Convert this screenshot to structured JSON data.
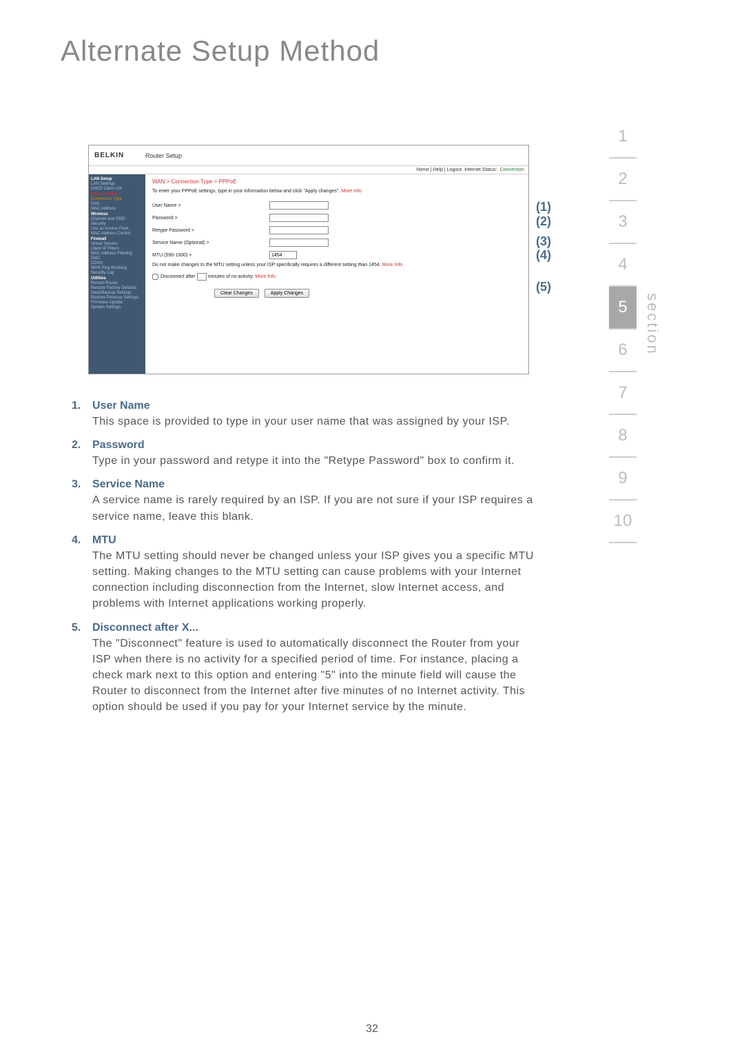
{
  "page_title": "Alternate Setup Method",
  "page_number": "32",
  "section_label": "section",
  "tabs": [
    "1",
    "2",
    "3",
    "4",
    "5",
    "6",
    "7",
    "8",
    "9",
    "10"
  ],
  "active_tab": 4,
  "screenshot": {
    "logo": "BELKIN",
    "title": "Router Setup",
    "status_links": "Home | Help | Logout",
    "status_label": "Internet Status:",
    "status_value": "Connection",
    "breadcrumb": "WAN > Connection Type > PPPoE",
    "instruction_prefix": "To enter your PPPoE settings, type in your information below and click \"Apply changes\". ",
    "more_info": "More Info",
    "sidebar": [
      {
        "text": "LAN Setup",
        "cls": "hdr"
      },
      {
        "text": "LAN Settings",
        "cls": "item"
      },
      {
        "text": "DHCP Client List",
        "cls": "item"
      },
      {
        "text": "Internet WAN",
        "cls": "hdr red"
      },
      {
        "text": "Connection Type",
        "cls": "item orange"
      },
      {
        "text": "DNS",
        "cls": "item"
      },
      {
        "text": "MAC Address",
        "cls": "item"
      },
      {
        "text": "Wireless",
        "cls": "hdr"
      },
      {
        "text": "Channel and SSID",
        "cls": "item"
      },
      {
        "text": "Security",
        "cls": "item"
      },
      {
        "text": "Use as Access Point",
        "cls": "item"
      },
      {
        "text": "MAC Address Control",
        "cls": "item"
      },
      {
        "text": "Firewall",
        "cls": "hdr"
      },
      {
        "text": "Virtual Servers",
        "cls": "item"
      },
      {
        "text": "Client IP Filters",
        "cls": "item"
      },
      {
        "text": "MAC Address Filtering",
        "cls": "item"
      },
      {
        "text": "DMZ",
        "cls": "item"
      },
      {
        "text": "DDNS",
        "cls": "item"
      },
      {
        "text": "WAN Ping Blocking",
        "cls": "item"
      },
      {
        "text": "Security Log",
        "cls": "item"
      },
      {
        "text": "Utilities",
        "cls": "hdr"
      },
      {
        "text": "Restart Router",
        "cls": "item"
      },
      {
        "text": "Restore Factory Defaults",
        "cls": "item"
      },
      {
        "text": "Save/Backup Settings",
        "cls": "item"
      },
      {
        "text": "Restore Previous Settings",
        "cls": "item"
      },
      {
        "text": "Firmware Update",
        "cls": "item"
      },
      {
        "text": "System Settings",
        "cls": "item"
      }
    ],
    "fields": {
      "username": "User Name >",
      "password": "Password >",
      "retype": "Retype Password >",
      "service": "Service Name (Optional) >",
      "mtu": "MTU (590-1500) >",
      "mtu_value": "1454"
    },
    "mtu_note_prefix": "Do not make changes to the MTU setting unless your ISP specifically requires a different setting than 1454. ",
    "disconnect_prefix": "Disconnect after",
    "disconnect_suffix_a": "minutes of no activity.",
    "buttons": {
      "clear": "Clear Changes",
      "apply": "Apply Changes"
    }
  },
  "callouts": {
    "c1": "(1)",
    "c2": "(2)",
    "c3": "(3)",
    "c4": "(4)",
    "c5": "(5)"
  },
  "list": [
    {
      "num": "1.",
      "title": "User Name",
      "text": "This space is provided to type in your user name that was assigned by your ISP."
    },
    {
      "num": "2.",
      "title": "Password",
      "text": "Type in your password and retype it into the \"Retype Password\" box to confirm it."
    },
    {
      "num": "3.",
      "title": "Service Name",
      "text": "A service name is rarely required by an ISP. If you are not sure if your ISP requires a service name, leave this blank."
    },
    {
      "num": "4.",
      "title": "MTU",
      "text": "The MTU setting should never be changed unless your ISP gives you a specific MTU setting. Making changes to the MTU setting can cause problems with your Internet connection including disconnection from the Internet, slow Internet access, and problems with Internet applications working properly."
    },
    {
      "num": "5.",
      "title": "Disconnect after X...",
      "text": "The \"Disconnect\" feature is used to automatically disconnect the Router from your ISP when there is no activity for a specified period of time. For instance, placing a check mark next to this option and entering \"5\" into the minute field will cause the Router to disconnect from the Internet after five minutes of no Internet activity. This option should be used if you pay for your Internet service by the minute."
    }
  ]
}
